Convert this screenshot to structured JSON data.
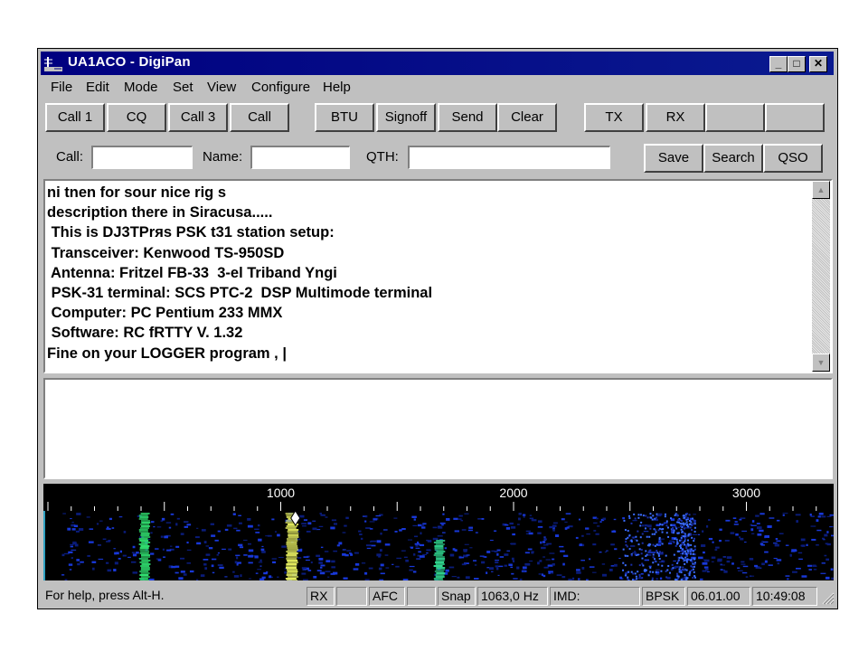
{
  "window": {
    "title": "UA1ACO - DigiPan",
    "minimize_glyph": "_",
    "maximize_glyph": "□",
    "close_glyph": "✕"
  },
  "menu": [
    "File",
    "Edit",
    "Mode",
    "Set",
    "View",
    "Configure",
    "Help"
  ],
  "macro_buttons": [
    "Call 1",
    "CQ",
    "Call 3",
    "Call",
    "BTU",
    "Signoff",
    "Send",
    "Clear",
    "TX",
    "RX",
    "",
    ""
  ],
  "fields": {
    "call_label": "Call:",
    "call_value": "",
    "name_label": "Name:",
    "name_value": "",
    "qth_label": "QTH:",
    "qth_value": "",
    "save_label": "Save",
    "search_label": "Search",
    "qso_label": "QSO"
  },
  "receive_text": "ni tnen for sour nice rig s\ndescription there in Siracusa.....\n This is DJ3TPrяs PSK t31 station setup:\n Transceiver: Kenwood TS-950SD\n Antenna: Fritzel FB-33  3-el Triband Yngi\n PSK-31 terminal: SCS PTC-2  DSP Multimode terminal\n Computer: PC Pentium 233 MMX\n Software: RC fRTTY V. 1.32\nFine on your LOGGER program , |",
  "transmit_text": "",
  "waterfall": {
    "scale_labels": [
      "1000",
      "2000",
      "3000"
    ],
    "scale_values": [
      1000,
      2000,
      3000
    ],
    "cursor_hz": 1063
  },
  "status": {
    "help": "For help, press Alt-H.",
    "rx": "RX",
    "afc": "AFC",
    "snap": "Snap",
    "freq": "1063,0 Hz",
    "imd": "IMD:",
    "mode": "BPSK",
    "date": "06.01.00",
    "time": "10:49:08"
  },
  "colors": {
    "titlebar": "#000080",
    "face": "#c0c0c0",
    "waterfall_bg": "#000000",
    "signal": "#e8f060",
    "noise": "#1030c0"
  }
}
